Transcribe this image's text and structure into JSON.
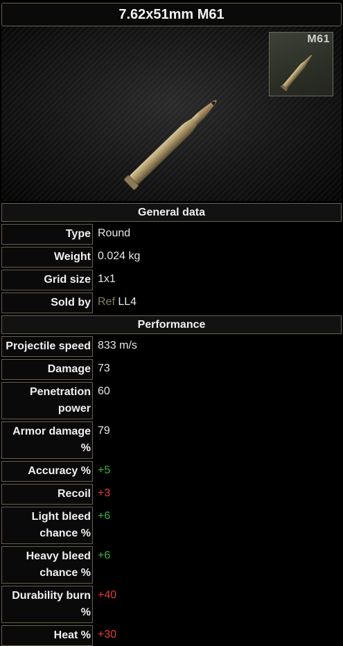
{
  "title": "7.62x51mm M61",
  "icon": {
    "label": "M61",
    "image": "bullet-cartridge"
  },
  "sections": {
    "general": "General data",
    "performance": "Performance"
  },
  "general": {
    "type": {
      "label": "Type",
      "value": "Round"
    },
    "weight": {
      "label": "Weight",
      "value": "0.024 kg"
    },
    "grid_size": {
      "label": "Grid size",
      "value": "1x1"
    },
    "sold_by": {
      "label": "Sold by",
      "trader": "Ref",
      "level": "LL4"
    }
  },
  "performance": {
    "projectile_speed": {
      "label": "Projectile speed",
      "value": "833 m/s"
    },
    "damage": {
      "label": "Damage",
      "value": "73"
    },
    "penetration_power": {
      "label": "Penetration power",
      "value": "60"
    },
    "armor_damage": {
      "label": "Armor damage %",
      "value": "79"
    },
    "accuracy": {
      "label": "Accuracy %",
      "value": "+5"
    },
    "recoil": {
      "label": "Recoil",
      "value": "+3"
    },
    "light_bleed": {
      "label": "Light bleed chance %",
      "value": "+6"
    },
    "heavy_bleed": {
      "label": "Heavy bleed chance %",
      "value": "+6"
    },
    "durability_burn": {
      "label": "Durability burn %",
      "value": "+40"
    },
    "heat": {
      "label": "Heat %",
      "value": "+30"
    }
  },
  "colors": {
    "positive": "#3bb43b",
    "negative": "#e43a3a",
    "trader_ref": "#8c7e5d",
    "border": "#6b6152"
  }
}
